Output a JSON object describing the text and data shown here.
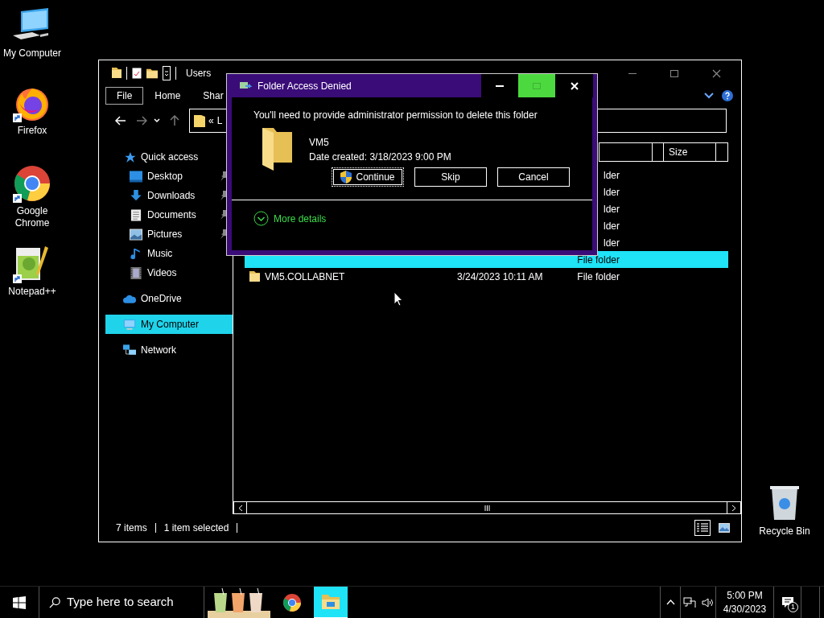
{
  "desktop_icons": [
    {
      "label": "My Computer",
      "kind": "computer"
    },
    {
      "label": "Firefox",
      "kind": "firefox"
    },
    {
      "label": "Google Chrome",
      "kind": "chrome"
    },
    {
      "label": "Notepad++",
      "kind": "notepad"
    }
  ],
  "recycle_bin": {
    "label": "Recycle Bin"
  },
  "explorer": {
    "title": "Users",
    "ribbon_tabs": [
      {
        "label": "File",
        "selected": true
      },
      {
        "label": "Home",
        "selected": false
      },
      {
        "label": "Shar",
        "selected": false
      }
    ],
    "address": {
      "separator": "«",
      "text": "L"
    },
    "nav_items": [
      {
        "label": "Quick access",
        "kind": "star",
        "pinned": false,
        "selected": false
      },
      {
        "label": "Desktop",
        "kind": "desktop",
        "pinned": true,
        "selected": false
      },
      {
        "label": "Downloads",
        "kind": "downloads",
        "pinned": true,
        "selected": false
      },
      {
        "label": "Documents",
        "kind": "documents",
        "pinned": true,
        "selected": false
      },
      {
        "label": "Pictures",
        "kind": "pictures",
        "pinned": true,
        "selected": false
      },
      {
        "label": "Music",
        "kind": "music",
        "pinned": false,
        "selected": false
      },
      {
        "label": "Videos",
        "kind": "videos",
        "pinned": false,
        "selected": false
      },
      {
        "label": "OneDrive",
        "kind": "cloud",
        "pinned": false,
        "selected": false
      },
      {
        "label": "My Computer",
        "kind": "computer",
        "pinned": false,
        "selected": true
      },
      {
        "label": "Network",
        "kind": "network",
        "pinned": false,
        "selected": false
      }
    ],
    "columns": [
      {
        "label": "Size"
      }
    ],
    "rows": [
      {
        "type": "lder",
        "selected": false
      },
      {
        "type": "lder",
        "selected": false
      },
      {
        "type": "lder",
        "selected": false
      },
      {
        "type": "lder",
        "selected": false
      },
      {
        "type": "lder",
        "selected": false
      },
      {
        "type": "File folder",
        "selected": true
      },
      {
        "name": "VM5.COLLABNET",
        "date": "3/24/2023 10:11 AM",
        "type": "File folder",
        "selected": false
      }
    ],
    "status": {
      "count": "7 items",
      "selection": "1 item selected"
    }
  },
  "dialog": {
    "title": "Folder Access Denied",
    "message": "You'll need to provide administrator permission to delete this folder",
    "item_name": "VM5",
    "item_date": "Date created: 3/18/2023 9:00 PM",
    "buttons": [
      {
        "label": "Continue",
        "kind": "shield",
        "focused": true
      },
      {
        "label": "Skip",
        "kind": "plain",
        "focused": false
      },
      {
        "label": "Cancel",
        "kind": "plain",
        "focused": false
      }
    ],
    "more_details": "More details"
  },
  "taskbar": {
    "search": {
      "placeholder": "Type here to search"
    },
    "apps": [
      {
        "kind": "widget",
        "active": false
      },
      {
        "kind": "chrome",
        "active": false
      },
      {
        "kind": "explorer",
        "active": true
      }
    ],
    "time": "5:00 PM",
    "date": "4/30/2023",
    "notifications": "1"
  }
}
